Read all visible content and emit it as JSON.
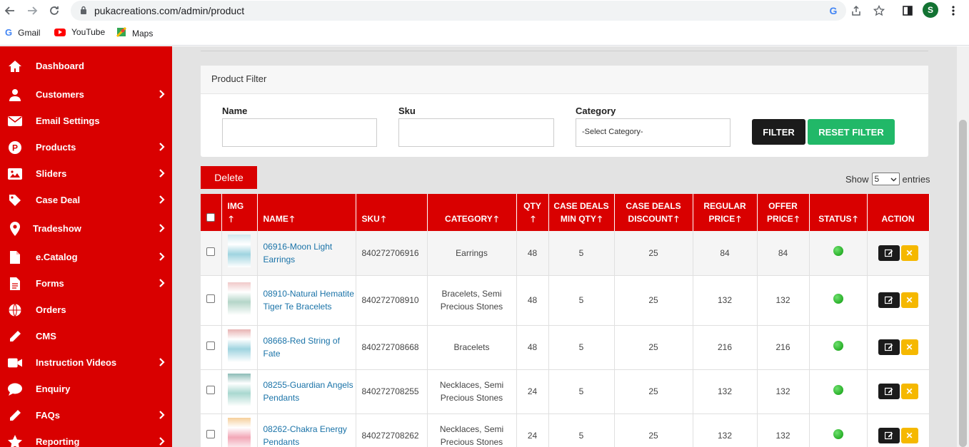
{
  "browser": {
    "url": "pukacreations.com/admin/product",
    "avatar_letter": "S",
    "bookmarks": [
      "Gmail",
      "YouTube",
      "Maps"
    ]
  },
  "sidebar": {
    "items": [
      {
        "label": "Dashboard",
        "icon": "home-icon",
        "chevron": false
      },
      {
        "label": "Customers",
        "icon": "user-icon",
        "chevron": true
      },
      {
        "label": "Email Settings",
        "icon": "envelope-icon",
        "chevron": false
      },
      {
        "label": "Products",
        "icon": "product-p-icon",
        "chevron": true
      },
      {
        "label": "Sliders",
        "icon": "image-icon",
        "chevron": true
      },
      {
        "label": "Case Deal",
        "icon": "tag-icon",
        "chevron": true
      },
      {
        "label": "Tradeshow",
        "icon": "map-pin-icon",
        "chevron": true
      },
      {
        "label": "e.Catalog",
        "icon": "file-icon",
        "chevron": true
      },
      {
        "label": "Forms",
        "icon": "form-file-icon",
        "chevron": true
      },
      {
        "label": "Orders",
        "icon": "globe-icon",
        "chevron": false
      },
      {
        "label": "CMS",
        "icon": "pencil-icon",
        "chevron": false
      },
      {
        "label": "Instruction Videos",
        "icon": "video-icon",
        "chevron": true
      },
      {
        "label": "Enquiry",
        "icon": "chat-icon",
        "chevron": false
      },
      {
        "label": "FAQs",
        "icon": "pencil-faq-icon",
        "chevron": true
      },
      {
        "label": "Reporting",
        "icon": "star-icon",
        "chevron": true
      }
    ]
  },
  "filter": {
    "title": "Product Filter",
    "name_label": "Name",
    "sku_label": "Sku",
    "category_label": "Category",
    "category_value": "-Select Category-",
    "filter_button": "FILTER",
    "reset_button": "RESET FILTER"
  },
  "actions": {
    "delete_button": "Delete",
    "show_label": "Show",
    "show_value": "5",
    "entries_label": "entries"
  },
  "table": {
    "headers": {
      "img": "IMG",
      "name": "NAME",
      "sku": "SKU",
      "category": "CATEGORY",
      "qty": "QTY",
      "case_min_1": "CASE DEALS",
      "case_min_2": "MIN QTY",
      "case_disc_1": "CASE DEALS",
      "case_disc_2": "DISCOUNT",
      "regular_1": "REGULAR",
      "regular_2": "PRICE",
      "offer_1": "OFFER",
      "offer_2": "PRICE",
      "status": "STATUS",
      "action": "ACTION"
    },
    "rows": [
      {
        "name": "06916-Moon Light Earrings",
        "sku": "840272706916",
        "category": "Earrings",
        "qty": "48",
        "min_qty": "5",
        "discount": "25",
        "regular": "84",
        "offer": "84"
      },
      {
        "name": "08910-Natural Hematite Tiger Te Bracelets",
        "sku": "840272708910",
        "category": "Bracelets, Semi Precious Stones",
        "qty": "48",
        "min_qty": "5",
        "discount": "25",
        "regular": "132",
        "offer": "132"
      },
      {
        "name": "08668-Red String of Fate",
        "sku": "840272708668",
        "category": "Bracelets",
        "qty": "48",
        "min_qty": "5",
        "discount": "25",
        "regular": "216",
        "offer": "216"
      },
      {
        "name": "08255-Guardian Angels Pendants",
        "sku": "840272708255",
        "category": "Necklaces, Semi Precious Stones",
        "qty": "24",
        "min_qty": "5",
        "discount": "25",
        "regular": "132",
        "offer": "132"
      },
      {
        "name": "08262-Chakra Energy Pendants",
        "sku": "840272708262",
        "category": "Necklaces, Semi Precious Stones",
        "qty": "24",
        "min_qty": "5",
        "discount": "25",
        "regular": "132",
        "offer": "132"
      }
    ]
  },
  "colors": {
    "brand_red": "#d90000",
    "reset_green": "#21b868",
    "status_green": "#0b9a0b",
    "delete_yellow": "#f5b800"
  }
}
